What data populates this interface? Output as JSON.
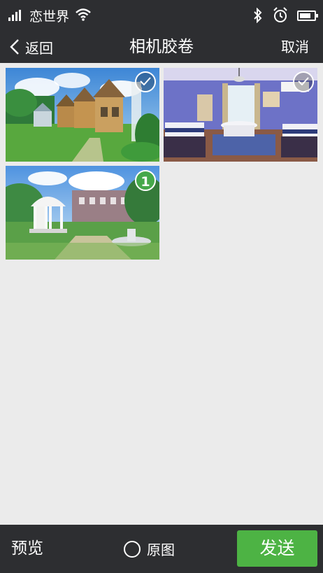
{
  "status_bar": {
    "carrier": "恋世界",
    "icons": [
      "signal-icon",
      "wifi-icon",
      "bluetooth-icon",
      "alarm-icon",
      "battery-icon"
    ],
    "battery_level": 0.8
  },
  "nav": {
    "back_label": "返回",
    "title": "相机胶卷",
    "cancel_label": "取消"
  },
  "photos": [
    {
      "description": "cottages-meadow",
      "selected": false
    },
    {
      "description": "bedroom",
      "selected": false
    },
    {
      "description": "garden-gazebo-fountain",
      "selected": true,
      "order": "1"
    }
  ],
  "bottom_bar": {
    "preview_label": "预览",
    "original_label": "原图",
    "original_checked": false,
    "send_label": "发送"
  },
  "colors": {
    "bar_background": "#2d2e31",
    "page_background": "#ebebeb",
    "accent_green": "#4db344"
  }
}
